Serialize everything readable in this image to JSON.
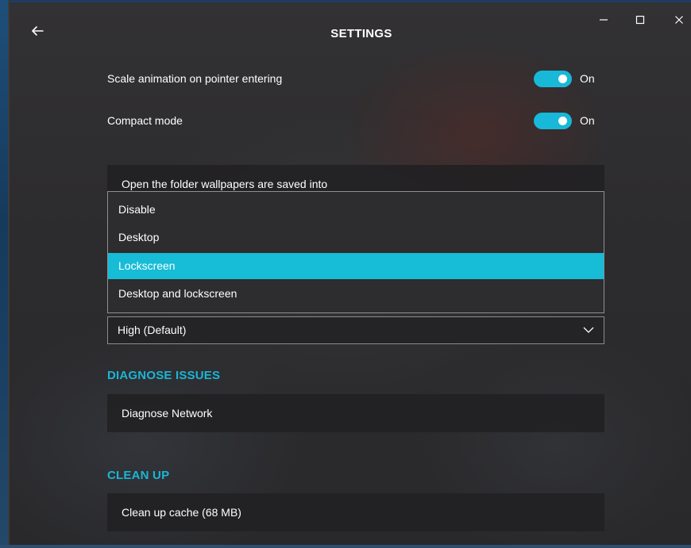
{
  "header": {
    "title": "SETTINGS",
    "back_icon": "back-arrow-icon"
  },
  "window_controls": {
    "minimize_icon": "minimize-icon",
    "maximize_icon": "maximize-icon",
    "close_icon": "close-icon"
  },
  "settings": {
    "scale_animation": {
      "label": "Scale animation on pointer entering",
      "state": "On",
      "enabled": true
    },
    "compact_mode": {
      "label": "Compact mode",
      "state": "On",
      "enabled": true
    }
  },
  "open_folder": {
    "label": "Open the folder wallpapers are saved into"
  },
  "dropdown": {
    "options": [
      {
        "label": "Disable"
      },
      {
        "label": "Desktop"
      },
      {
        "label": "Lockscreen"
      },
      {
        "label": "Desktop and lockscreen"
      }
    ],
    "selected_index": 2
  },
  "quality_select": {
    "value": "High (Default)",
    "chevron_icon": "chevron-down-icon"
  },
  "diagnose": {
    "heading": "DIAGNOSE ISSUES",
    "network_label": "Diagnose Network"
  },
  "clean_up": {
    "heading": "CLEAN UP",
    "cache_label": "Clean up cache (68 MB)"
  },
  "colors": {
    "accent": "#18b8d8",
    "heading_accent": "#1ab6d6",
    "background": "#2c2b2d",
    "card": "#212022",
    "border": "#8f8f92"
  }
}
